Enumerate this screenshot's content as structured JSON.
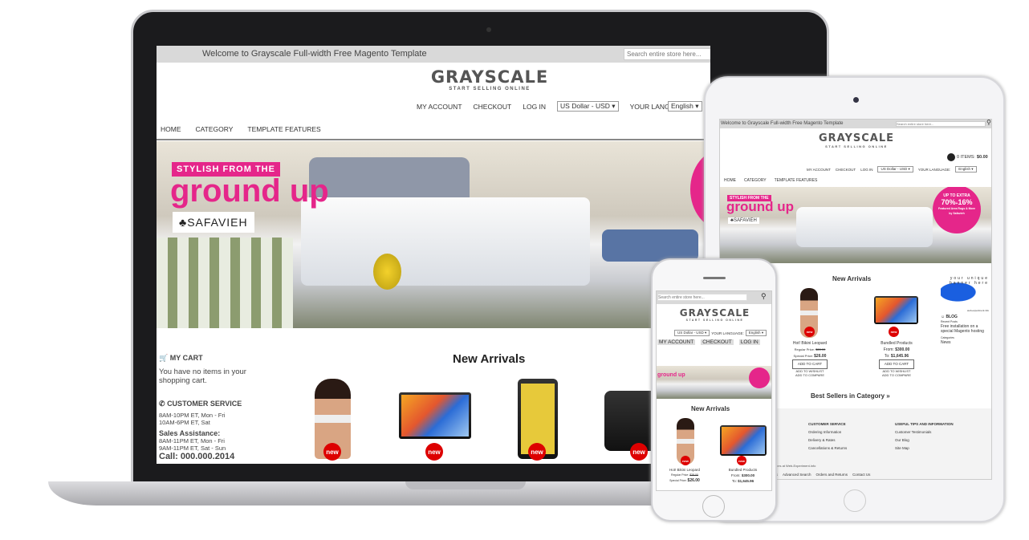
{
  "store": {
    "welcome": "Welcome to Grayscale Full-width Free Magento Template",
    "search_placeholder": "Search entire store here...",
    "logo": "GRAYSCALE",
    "tagline": "START SELLING ONLINE",
    "links": {
      "account": "MY ACCOUNT",
      "checkout": "CHECKOUT",
      "login": "LOG IN"
    },
    "currency": "US Dollar - USD",
    "language_label": "YOUR LANGUAGE:",
    "language": "English",
    "cart_summary": {
      "items": "0 ITEMS:",
      "total": "$0.00"
    },
    "nav": [
      "HOME",
      "CATEGORY",
      "TEMPLATE FEATURES"
    ],
    "banner": {
      "headline_small": "STYLISH FROM THE",
      "headline_big": "ground up",
      "brand": "SAFAVIEH",
      "promo_up_to": "UP TO",
      "promo_pct1": "70%",
      "promo_extra": "EXTRA",
      "promo_pct2": "16%",
      "promo_text": "Featured Area Rugs & More by Safavieh"
    },
    "sidebar": {
      "cart_title": "MY CART",
      "cart_text": "You have no items in your shopping cart.",
      "service_title": "CUSTOMER SERVICE",
      "hours1": "8AM-10PM ET, Mon - Fri",
      "hours2": "10AM-6PM ET, Sat",
      "sales_title": "Sales Assistance:",
      "sales1": "8AM-11PM ET, Mon - Fri",
      "sales2": "9AM-11PM ET, Sat - Sun",
      "call": "Call: 000.000.2014"
    },
    "new_arrivals": "New Arrivals",
    "new_badge": "new",
    "products": [
      {
        "name": "Hot! Bikini Leopard",
        "regular_label": "Regular Price:",
        "regular": "$28.00",
        "special_label": "Special Price:",
        "special": "$26.00"
      },
      {
        "name": "Bundled Products",
        "from_label": "From:",
        "from": "$300.00",
        "to_label": "To:",
        "to": "$1,645.96"
      }
    ],
    "add_to_cart": "ADD TO CART",
    "add_wishlist": "ADD TO WISHLIST",
    "add_compare": "ADD TO COMPARE",
    "blog": {
      "ad_text": "your unique banner here",
      "ad_url": "web-experiment.info",
      "title": "BLOG",
      "recent_label": "Recent Posts",
      "post": "Free installation on a special Magento hosting",
      "categories_label": "Categories",
      "category": "News"
    },
    "best_sellers": "Best Sellers in Category »",
    "footer": {
      "col1_title": "CUSTOMER SERVICE",
      "col1": [
        "Ordering Information",
        "Delivery & Rates",
        "Cancellations & Returns"
      ],
      "col2_title": "USEFUL TIPS AND INFORMATION",
      "col2": [
        "Customer Testimonials",
        "Our Blog",
        "Site Map"
      ],
      "credit": "o themes at Web-Experiment.info",
      "links": [
        "erms",
        "Advanced Search",
        "Orders and Returns",
        "Contact Us"
      ]
    }
  },
  "colors": {
    "accent": "#e5268a",
    "badge": "#dd0000",
    "topbar": "#d9d9d9"
  }
}
